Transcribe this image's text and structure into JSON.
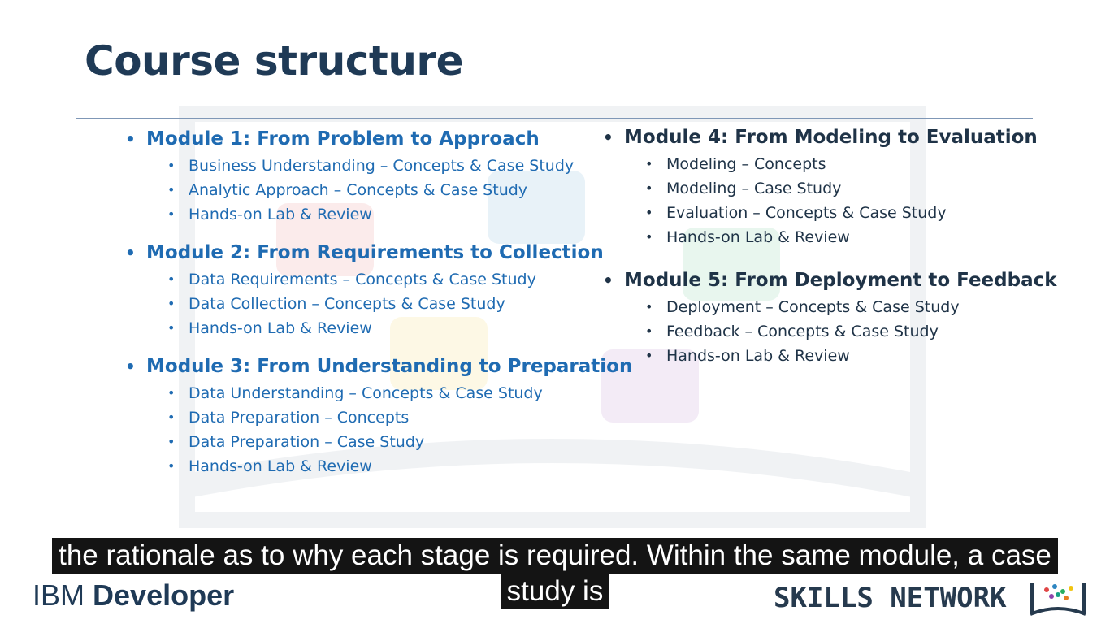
{
  "slide": {
    "title": "Course structure",
    "left_modules": [
      {
        "title": "Module 1: From Problem to Approach",
        "items": [
          "Business Understanding – Concepts & Case Study",
          "Analytic Approach – Concepts & Case Study",
          "Hands-on Lab & Review"
        ]
      },
      {
        "title": "Module 2: From Requirements to Collection",
        "items": [
          "Data Requirements – Concepts & Case Study",
          "Data Collection – Concepts & Case Study",
          "Hands-on Lab & Review"
        ]
      },
      {
        "title": "Module 3: From Understanding to Preparation",
        "items": [
          "Data Understanding – Concepts & Case Study",
          "Data Preparation – Concepts",
          "Data Preparation – Case Study",
          "Hands-on Lab & Review"
        ]
      }
    ],
    "right_modules": [
      {
        "title": "Module 4: From Modeling to Evaluation",
        "items": [
          "Modeling – Concepts",
          "Modeling – Case Study",
          "Evaluation – Concepts & Case Study",
          "Hands-on Lab & Review"
        ]
      },
      {
        "title": "Module 5: From Deployment to Feedback",
        "items": [
          "Deployment – Concepts & Case Study",
          "Feedback – Concepts & Case Study",
          "Hands-on Lab & Review"
        ]
      }
    ]
  },
  "caption": {
    "line1": "the rationale as to why each stage is required. Within the same module, a case",
    "line2": "study is"
  },
  "footer": {
    "ibm_prefix": "IBM",
    "ibm_developer": "Developer",
    "skills_network": "SKILLS NETWORK",
    "logo_icon": "skills-network-book-icon"
  },
  "colors": {
    "title": "#1f3a56",
    "left_text": "#1f6bb2",
    "right_text": "#1f3347",
    "caption_bg": "#141414"
  }
}
